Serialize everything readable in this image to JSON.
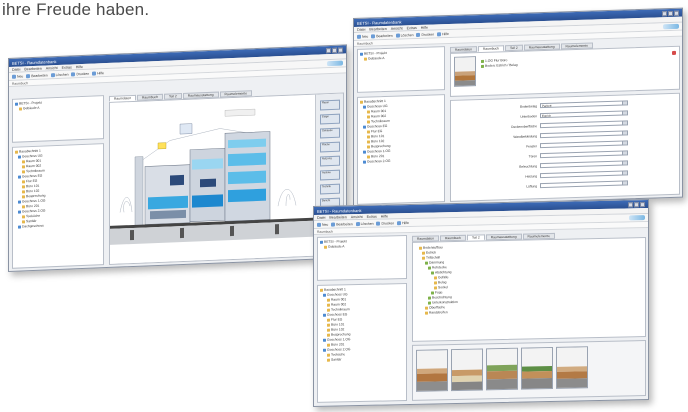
{
  "caption": "ihre Freude haben.",
  "app": {
    "title": "BETSI - Raumdatenbank",
    "menu": [
      "Datei",
      "Bearbeiten",
      "Ansicht",
      "Extras",
      "Hilfe"
    ],
    "toolbar": [
      "Neu",
      "Bearbeiten",
      "Löschen",
      "Drucken",
      "Hilfe"
    ],
    "address": "Raumbuch"
  },
  "tabs": [
    "Raumdaten",
    "Raumbuch",
    "Teil 2",
    "Raumausstattung",
    "Raumelemente"
  ],
  "left_tree_top": [
    "BETSI - Projekt",
    "Gebäude A"
  ],
  "left_tree_bottom": [
    "Bauabschnitt 1",
    "Geschoss UG",
    "Raum 001",
    "Raum 002",
    "Technikraum",
    "Geschoss EG",
    "Flur EG",
    "Büro 101",
    "Büro 102",
    "Besprechung",
    "Geschoss 1.OG",
    "Büro 201",
    "Geschoss 2.OG",
    "Teeküche",
    "Sanitär",
    "Dachgeschoss"
  ],
  "window1": {
    "side_buttons": [
      "Raum",
      "Etage",
      "Gebäude",
      "Fläche",
      "Nutzung",
      "Ausbau",
      "Technik",
      "Bericht"
    ]
  },
  "window2": {
    "header_lines": [
      "1.OG Flur Büro",
      "Boden: Estrich / Belag"
    ],
    "form": [
      {
        "label": "Bodenbelag",
        "value": "Parkett"
      },
      {
        "label": "Unterboden",
        "value": "Estrich"
      },
      {
        "label": "Deckenoberfläche",
        "value": ""
      },
      {
        "label": "Wandbekleidung",
        "value": ""
      },
      {
        "label": "Fenster",
        "value": ""
      },
      {
        "label": "Türen",
        "value": ""
      },
      {
        "label": "Beleuchtung",
        "value": ""
      },
      {
        "label": "Heizung",
        "value": ""
      },
      {
        "label": "Lüftung",
        "value": ""
      }
    ]
  },
  "window3": {
    "tree": [
      "Bodenaufbau",
      "Estrich",
      "Trittschall",
      "Dämmung",
      "Rohdecke",
      "Abdichtung",
      "Gefälle",
      "Belag",
      "Sockel",
      "Fuge",
      "Beschichtung",
      "Unterkonstruktion",
      "Oberfläche",
      "Randstreifen"
    ]
  }
}
